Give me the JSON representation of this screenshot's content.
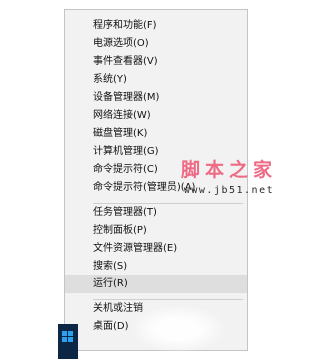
{
  "menu": {
    "items": [
      {
        "label": "程序和功能(F)"
      },
      {
        "label": "电源选项(O)"
      },
      {
        "label": "事件查看器(V)"
      },
      {
        "label": "系统(Y)"
      },
      {
        "label": "设备管理器(M)"
      },
      {
        "label": "网络连接(W)"
      },
      {
        "label": "磁盘管理(K)"
      },
      {
        "label": "计算机管理(G)"
      },
      {
        "label": "命令提示符(C)"
      },
      {
        "label": "命令提示符(管理员)(A)"
      },
      {
        "label": "任务管理器(T)"
      },
      {
        "label": "控制面板(P)"
      },
      {
        "label": "文件资源管理器(E)"
      },
      {
        "label": "搜索(S)"
      },
      {
        "label": "运行(R)",
        "highlighted": true
      },
      {
        "label": "关机或注销"
      },
      {
        "label": "桌面(D)"
      }
    ]
  },
  "watermark": {
    "title": "脚本之家",
    "url": "www.jb51.net",
    "color": "#ee6b85"
  },
  "taskbar": {
    "start_label": "桌面(D)",
    "icon": "windows-logo-icon",
    "background": "#0b2745"
  }
}
